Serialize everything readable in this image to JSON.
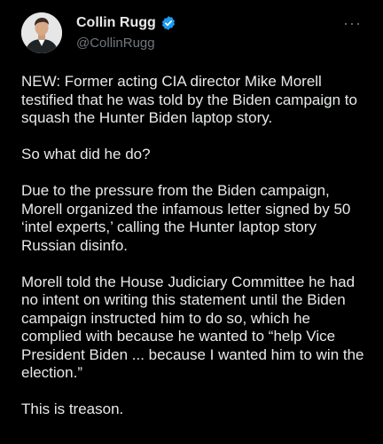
{
  "author": {
    "display_name": "Collin Rugg",
    "handle": "@CollinRugg",
    "verified_icon": "verified-badge-icon",
    "avatar_icon": "avatar-photo"
  },
  "more_icon": "more-horizontal-icon",
  "more_label": "···",
  "tweet": {
    "paragraphs": [
      "NEW: Former acting CIA director Mike Morell testified that he was told by the Biden campaign to squash the Hunter Biden laptop story.",
      "So what did he do?",
      "Due to the pressure from the Biden campaign, Morell organized the infamous letter signed by 50 ‘intel experts,’ calling the Hunter laptop story Russian disinfo.",
      "Morell told the House Judiciary Committee he had no intent on writing this statement until the Biden campaign instructed him to do so, which he complied with because he wanted to “help Vice President Biden ... because I wanted him to win the election.”",
      "This is treason."
    ]
  },
  "colors": {
    "background": "#000000",
    "text": "#e7e9ea",
    "muted": "#71767b",
    "verified": "#1d9bf0"
  }
}
